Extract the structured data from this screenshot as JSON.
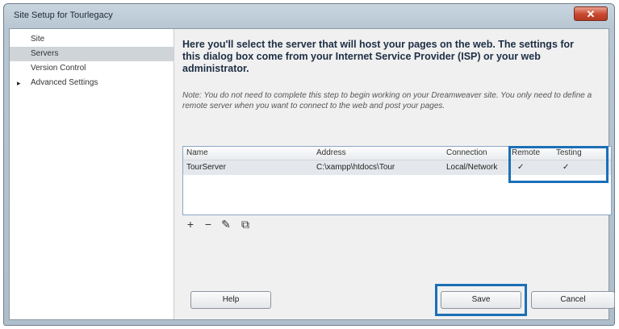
{
  "window": {
    "title": "Site Setup for Tourlegacy",
    "close_label": "✕"
  },
  "sidebar": {
    "items": [
      {
        "label": "Site"
      },
      {
        "label": "Servers",
        "selected": true
      },
      {
        "label": "Version Control"
      },
      {
        "label": "Advanced Settings",
        "bullet": "▸"
      }
    ]
  },
  "main": {
    "intro": "Here you'll select the server that will host your pages on the web. The settings for this dialog box come from your Internet Service Provider (ISP) or your web administrator.",
    "note": "Note: You do not need to complete this step to begin working on your Dreamweaver site. You only need to define a remote server when you want to connect to the web and post your pages.",
    "table": {
      "headers": [
        "Name",
        "Address",
        "Connection",
        "Remote",
        "Testing"
      ],
      "rows": [
        {
          "name": "TourServer",
          "address": "C:\\xampp\\htdocs\\Tour",
          "connection": "Local/Network",
          "remote": "✓",
          "testing": "✓"
        }
      ]
    },
    "toolbar": {
      "add": "+",
      "remove": "−",
      "edit": "✎",
      "duplicate": "⧉"
    }
  },
  "buttons": {
    "help": "Help",
    "save": "Save",
    "cancel": "Cancel"
  },
  "colors": {
    "highlight": "#1b6fb6"
  }
}
